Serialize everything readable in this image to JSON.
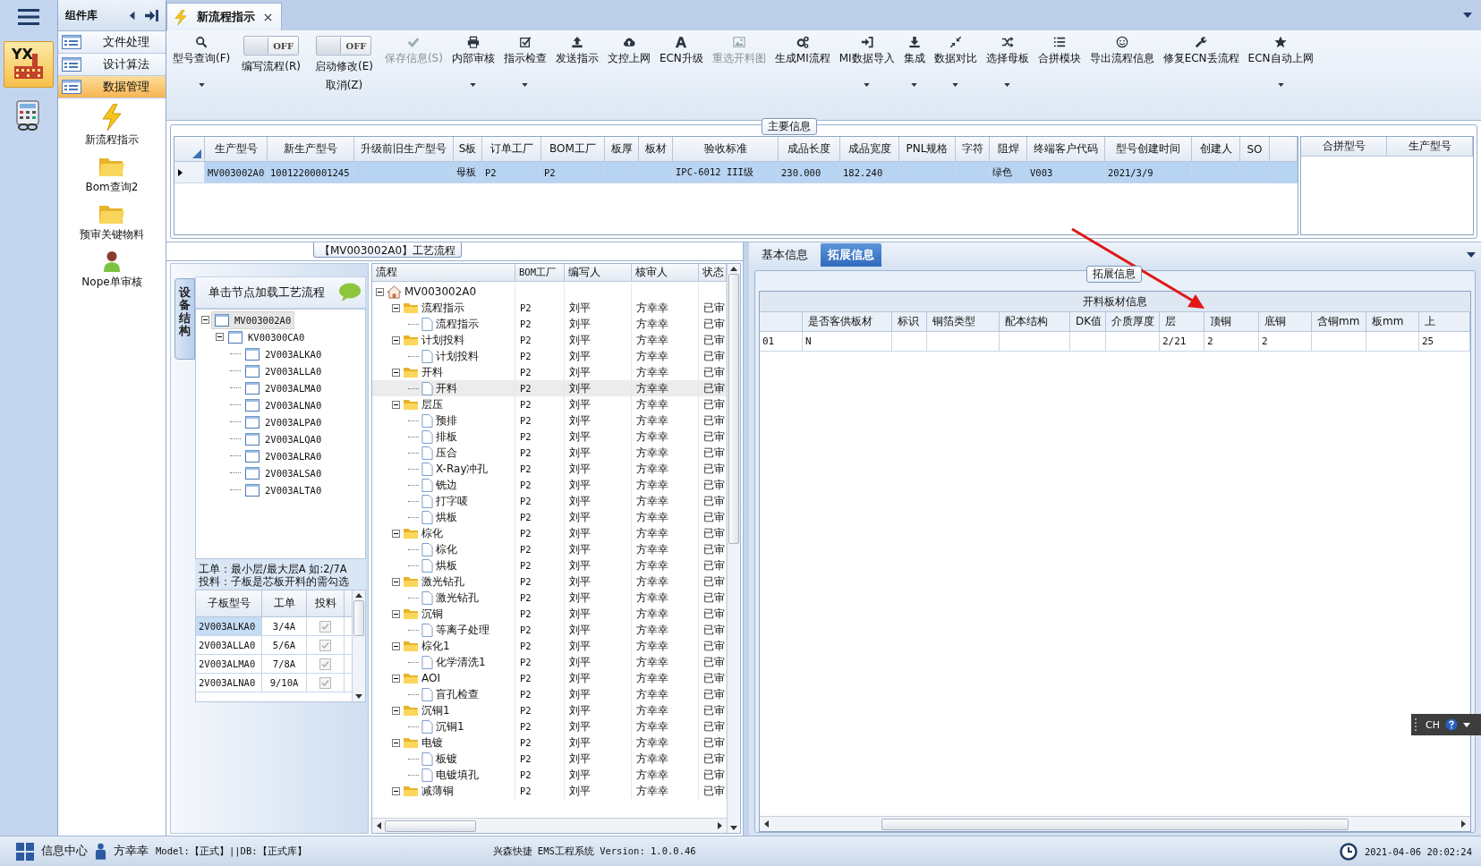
{
  "nav_rail": {
    "items": [
      {
        "label": "YX",
        "selected": true
      },
      {
        "selected": false
      }
    ]
  },
  "component_panel": {
    "title": "组件库",
    "categories": [
      {
        "label": "文件处理",
        "selected": false
      },
      {
        "label": "设计算法",
        "selected": false
      },
      {
        "label": "数据管理",
        "selected": true
      }
    ],
    "tools": [
      {
        "label": "新流程指示"
      },
      {
        "label": "Bom查询2"
      },
      {
        "label": "预审关键物料"
      },
      {
        "label": "Nope单审核"
      }
    ]
  },
  "tabs": [
    {
      "label": "新流程指示",
      "selected": true
    }
  ],
  "toolbar": [
    {
      "kind": "button",
      "label": "型号查询(F)",
      "dropdown": true,
      "disabled": false
    },
    {
      "kind": "toggle",
      "label": "编写流程(R)",
      "switch_text": "OFF",
      "on": false
    },
    {
      "kind": "toggle",
      "label": "启动修改(E)",
      "label2": "取消(Z)",
      "switch_text": "OFF",
      "on": false
    },
    {
      "kind": "button",
      "label": "保存信息(S)",
      "dropdown": false,
      "disabled": true
    },
    {
      "kind": "button",
      "label": "内部审核",
      "dropdown": true,
      "disabled": false
    },
    {
      "kind": "button",
      "label": "指示检查",
      "dropdown": true,
      "disabled": false
    },
    {
      "kind": "button",
      "label": "发送指示",
      "dropdown": false,
      "disabled": false
    },
    {
      "kind": "button",
      "label": "文控上网",
      "dropdown": false,
      "disabled": false
    },
    {
      "kind": "button",
      "label": "ECN升级",
      "dropdown": false,
      "disabled": false
    },
    {
      "kind": "button",
      "label": "重选开料图",
      "dropdown": false,
      "disabled": true
    },
    {
      "kind": "button",
      "label": "生成MI流程",
      "dropdown": false,
      "disabled": false
    },
    {
      "kind": "button",
      "label": "MI数据导入",
      "dropdown": true,
      "disabled": false
    },
    {
      "kind": "button",
      "label": "集成",
      "dropdown": true,
      "disabled": false
    },
    {
      "kind": "button",
      "label": "数据对比",
      "dropdown": true,
      "disabled": false
    },
    {
      "kind": "button",
      "label": "选择母板",
      "dropdown": true,
      "disabled": false
    },
    {
      "kind": "button",
      "label": "合拼模块",
      "dropdown": false,
      "disabled": false
    },
    {
      "kind": "button",
      "label": "导出流程信息",
      "dropdown": false,
      "disabled": false
    },
    {
      "kind": "button",
      "label": "修复ECN丢流程",
      "dropdown": false,
      "disabled": false
    },
    {
      "kind": "button",
      "label": "ECN自动上网",
      "dropdown": true,
      "disabled": false
    }
  ],
  "main_info": {
    "title": "主要信息",
    "columns": [
      "生产型号",
      "新生产型号",
      "升级前旧生产型号",
      "S板",
      "订单工厂",
      "BOM工厂",
      "板厚",
      "板材",
      "验收标准",
      "成品长度",
      "成品宽度",
      "PNL规格",
      "字符",
      "阻焊",
      "终端客户代码",
      "型号创建时间",
      "创建人",
      "SO"
    ],
    "rows": [
      {
        "selected": true,
        "cells": [
          "MV003002A0",
          "10012200001245",
          null,
          "母板",
          "P2",
          "P2",
          null,
          null,
          "IPC-6012 III级",
          "230.000",
          "182.240",
          null,
          null,
          "绿色",
          "V003",
          "2021/3/9",
          null,
          null
        ]
      }
    ],
    "side_columns": [
      "合拼型号",
      "生产型号"
    ]
  },
  "flow_panel": {
    "title": "【MV003002A0】工艺流程",
    "structure_tab": "设备结构",
    "structure_header": "单击节点加载工艺流程",
    "structure_tree": {
      "label": "MV003002A0",
      "expanded": true,
      "selected": true,
      "children": [
        {
          "label": "KV00300CA0",
          "expanded": true,
          "selected": false,
          "children": [
            {
              "label": "2V003ALKA0",
              "selected": false
            },
            {
              "label": "2V003ALLA0",
              "selected": false
            },
            {
              "label": "2V003ALMA0",
              "selected": false
            },
            {
              "label": "2V003ALNA0",
              "selected": false
            },
            {
              "label": "2V003ALPA0",
              "selected": false
            },
            {
              "label": "2V003ALQA0",
              "selected": false
            },
            {
              "label": "2V003ALRA0",
              "selected": false
            },
            {
              "label": "2V003ALSA0",
              "selected": false
            },
            {
              "label": "2V003ALTA0",
              "selected": false
            }
          ]
        }
      ]
    },
    "notes": [
      "工单：最小层/最大层A 如:2/7A",
      "投料：子板是芯板开料的需勾选"
    ],
    "sub_boards": {
      "columns": [
        "子板型号",
        "工单",
        "投料"
      ],
      "rows": [
        {
          "model": "2V003ALKA0",
          "order": "3/4A",
          "checked": true,
          "selected": true
        },
        {
          "model": "2V003ALLA0",
          "order": "5/6A",
          "checked": true,
          "selected": false
        },
        {
          "model": "2V003ALMA0",
          "order": "7/8A",
          "checked": true,
          "selected": false
        },
        {
          "model": "2V003ALNA0",
          "order": "9/10A",
          "checked": true,
          "selected": false
        }
      ]
    },
    "flow_columns": [
      "流程",
      "BOM工厂",
      "编写人",
      "核审人",
      "状态"
    ],
    "flow_tree": {
      "label": "MV003002A0",
      "expanded": true,
      "selected": false,
      "children": [
        {
          "label": "流程指示",
          "bom": "P2",
          "writer": "刘平",
          "reviewer": "方幸幸",
          "status": "已审",
          "expanded": true,
          "selected": false,
          "children": [
            {
              "label": "流程指示",
              "bom": "P2",
              "writer": "刘平",
              "reviewer": "方幸幸",
              "status": "已审",
              "selected": false
            }
          ]
        },
        {
          "label": "计划投料",
          "bom": "P2",
          "writer": "刘平",
          "reviewer": "方幸幸",
          "status": "已审",
          "expanded": true,
          "selected": false,
          "children": [
            {
              "label": "计划投料",
              "bom": "P2",
              "writer": "刘平",
              "reviewer": "方幸幸",
              "status": "已审",
              "selected": false
            }
          ]
        },
        {
          "label": "开料",
          "bom": "P2",
          "writer": "刘平",
          "reviewer": "方幸幸",
          "status": "已审",
          "expanded": true,
          "selected": false,
          "children": [
            {
              "label": "开料",
              "bom": "P2",
              "writer": "刘平",
              "reviewer": "方幸幸",
              "status": "已审",
              "selected": true
            }
          ]
        },
        {
          "label": "层压",
          "bom": "P2",
          "writer": "刘平",
          "reviewer": "方幸幸",
          "status": "已审",
          "expanded": true,
          "selected": false,
          "children": [
            {
              "label": "预排",
              "bom": "P2",
              "writer": "刘平",
              "reviewer": "方幸幸",
              "status": "已审",
              "selected": false
            },
            {
              "label": "排板",
              "bom": "P2",
              "writer": "刘平",
              "reviewer": "方幸幸",
              "status": "已审",
              "selected": false
            },
            {
              "label": "压合",
              "bom": "P2",
              "writer": "刘平",
              "reviewer": "方幸幸",
              "status": "已审",
              "selected": false
            },
            {
              "label": "X-Ray冲孔",
              "bom": "P2",
              "writer": "刘平",
              "reviewer": "方幸幸",
              "status": "已审",
              "selected": false
            },
            {
              "label": "铣边",
              "bom": "P2",
              "writer": "刘平",
              "reviewer": "方幸幸",
              "status": "已审",
              "selected": false
            },
            {
              "label": "打字唛",
              "bom": "P2",
              "writer": "刘平",
              "reviewer": "方幸幸",
              "status": "已审",
              "selected": false
            },
            {
              "label": "烘板",
              "bom": "P2",
              "writer": "刘平",
              "reviewer": "方幸幸",
              "status": "已审",
              "selected": false
            }
          ]
        },
        {
          "label": "棕化",
          "bom": "P2",
          "writer": "刘平",
          "reviewer": "方幸幸",
          "status": "已审",
          "expanded": true,
          "selected": false,
          "children": [
            {
              "label": "棕化",
              "bom": "P2",
              "writer": "刘平",
              "reviewer": "方幸幸",
              "status": "已审",
              "selected": false
            },
            {
              "label": "烘板",
              "bom": "P2",
              "writer": "刘平",
              "reviewer": "方幸幸",
              "status": "已审",
              "selected": false
            }
          ]
        },
        {
          "label": "激光钻孔",
          "bom": "P2",
          "writer": "刘平",
          "reviewer": "方幸幸",
          "status": "已审",
          "expanded": true,
          "selected": false,
          "children": [
            {
              "label": "激光钻孔",
              "bom": "P2",
              "writer": "刘平",
              "reviewer": "方幸幸",
              "status": "已审",
              "selected": false
            }
          ]
        },
        {
          "label": "沉铜",
          "bom": "P2",
          "writer": "刘平",
          "reviewer": "方幸幸",
          "status": "已审",
          "expanded": true,
          "selected": false,
          "children": [
            {
              "label": "等离子处理",
              "bom": "P2",
              "writer": "刘平",
              "reviewer": "方幸幸",
              "status": "已审",
              "selected": false
            }
          ]
        },
        {
          "label": "棕化1",
          "bom": "P2",
          "writer": "刘平",
          "reviewer": "方幸幸",
          "status": "已审",
          "expanded": true,
          "selected": false,
          "children": [
            {
              "label": "化学清洗1",
              "bom": "P2",
              "writer": "刘平",
              "reviewer": "方幸幸",
              "status": "已审",
              "selected": false
            }
          ]
        },
        {
          "label": "AOI",
          "bom": "P2",
          "writer": "刘平",
          "reviewer": "方幸幸",
          "status": "已审",
          "expanded": true,
          "selected": false,
          "children": [
            {
              "label": "盲孔检查",
              "bom": "P2",
              "writer": "刘平",
              "reviewer": "方幸幸",
              "status": "已审",
              "selected": false
            }
          ]
        },
        {
          "label": "沉铜1",
          "bom": "P2",
          "writer": "刘平",
          "reviewer": "方幸幸",
          "status": "已审",
          "expanded": true,
          "selected": false,
          "children": [
            {
              "label": "沉铜1",
              "bom": "P2",
              "writer": "刘平",
              "reviewer": "方幸幸",
              "status": "已审",
              "selected": false
            }
          ]
        },
        {
          "label": "电镀",
          "bom": "P2",
          "writer": "刘平",
          "reviewer": "方幸幸",
          "status": "已审",
          "expanded": true,
          "selected": false,
          "children": [
            {
              "label": "板镀",
              "bom": "P2",
              "writer": "刘平",
              "reviewer": "方幸幸",
              "status": "已审",
              "selected": false
            },
            {
              "label": "电镀填孔",
              "bom": "P2",
              "writer": "刘平",
              "reviewer": "方幸幸",
              "status": "已审",
              "selected": false
            }
          ]
        },
        {
          "label": "减薄铜",
          "bom": "P2",
          "writer": "刘平",
          "reviewer": "方幸幸",
          "status": "已审",
          "expanded": true,
          "selected": false
        }
      ]
    }
  },
  "detail_panel": {
    "tabs": [
      {
        "label": "基本信息",
        "selected": false
      },
      {
        "label": "拓展信息",
        "selected": true
      }
    ],
    "group_title": "拓展信息",
    "grid_title": "开料板材信息",
    "columns": [
      null,
      "是否客供板材",
      "标识",
      "铜箔类型",
      "配本结构",
      "DK值",
      "介质厚度",
      "层",
      "顶铜",
      "底铜",
      "含铜mm",
      "板mm",
      "上"
    ],
    "rows": [
      {
        "cells": [
          "01",
          "N",
          null,
          null,
          null,
          null,
          null,
          "2/21",
          "2",
          "2",
          null,
          null,
          "25"
        ]
      }
    ]
  },
  "status_bar": {
    "info_center": "信息中心",
    "user": "方幸幸",
    "environment": "Model:【正式】||DB:【正式库】",
    "version": "兴森快捷 EMS工程系统 Version: 1.0.0.46",
    "datetime": "2021-04-06 20:02:24"
  },
  "ime": {
    "label": "CH"
  }
}
